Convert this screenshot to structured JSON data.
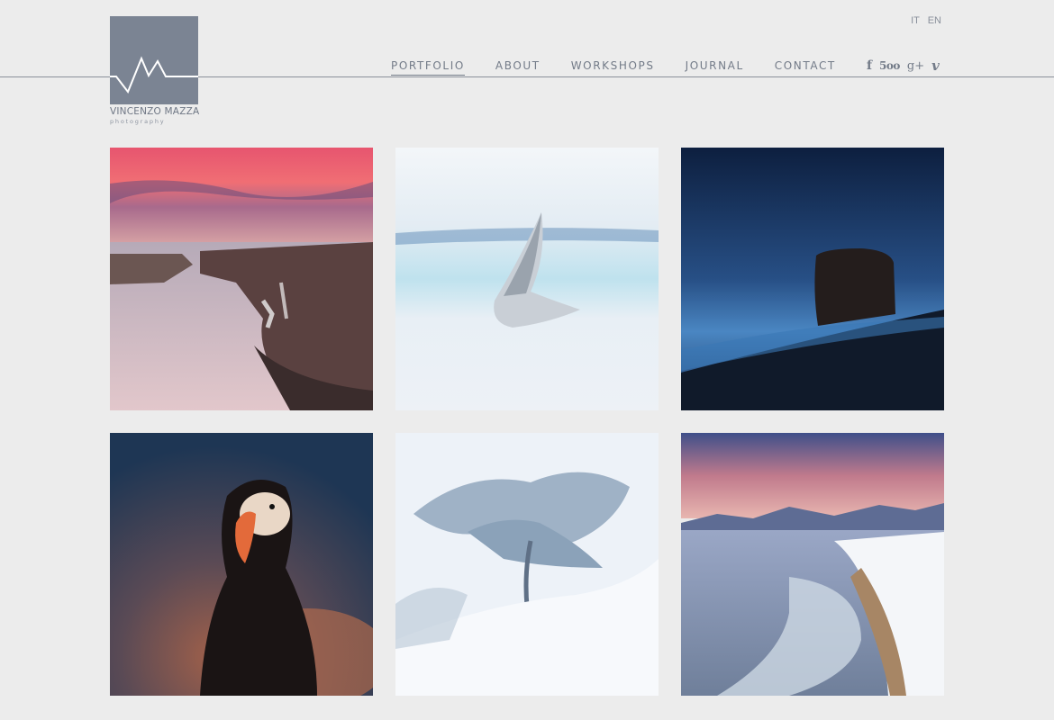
{
  "brand": {
    "name": "VINCENZO MAZZA",
    "tagline": "photography"
  },
  "lang": [
    "IT",
    "EN"
  ],
  "nav": [
    {
      "label": "PORTFOLIO",
      "active": true
    },
    {
      "label": "ABOUT",
      "active": false
    },
    {
      "label": "WORKSHOPS",
      "active": false
    },
    {
      "label": "JOURNAL",
      "active": false
    },
    {
      "label": "CONTACT",
      "active": false
    }
  ],
  "social": [
    {
      "icon": "facebook-icon",
      "glyph": "f"
    },
    {
      "icon": "500px-icon",
      "glyph": "5oo"
    },
    {
      "icon": "google-plus-icon",
      "glyph": "g+"
    },
    {
      "icon": "vimeo-icon",
      "glyph": "v"
    }
  ],
  "gallery": [
    {
      "name": "photo-waterfall-canyon"
    },
    {
      "name": "photo-seagull-flight"
    },
    {
      "name": "photo-sea-stack-night"
    },
    {
      "name": "photo-puffin-portrait"
    },
    {
      "name": "photo-snowy-tree"
    },
    {
      "name": "photo-frozen-lake-shore"
    }
  ]
}
